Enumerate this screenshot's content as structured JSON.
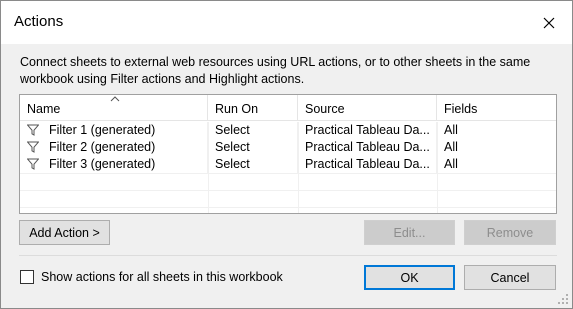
{
  "window": {
    "title": "Actions",
    "description": "Connect sheets to external web resources using URL actions, or to other sheets in the same workbook using Filter actions and Highlight actions."
  },
  "list": {
    "columns": [
      "Name",
      "Run On",
      "Source",
      "Fields"
    ],
    "rows": [
      {
        "icon": "filter-icon",
        "name": "Filter 1 (generated)",
        "run_on": "Select",
        "source": "Practical Tableau Da...",
        "fields": "All"
      },
      {
        "icon": "filter-icon",
        "name": "Filter 2 (generated)",
        "run_on": "Select",
        "source": "Practical Tableau Da...",
        "fields": "All"
      },
      {
        "icon": "filter-icon",
        "name": "Filter 3 (generated)",
        "run_on": "Select",
        "source": "Practical Tableau Da...",
        "fields": "All"
      }
    ]
  },
  "buttons": {
    "add_action": "Add Action >",
    "edit": "Edit...",
    "remove": "Remove",
    "ok": "OK",
    "cancel": "Cancel"
  },
  "options": {
    "show_all_label": "Show actions for all sheets in this workbook",
    "show_all_checked": false
  },
  "colors": {
    "accent": "#0078d7",
    "dialog_bg": "#f0f0f0",
    "disabled_text": "#8d8d8d"
  }
}
